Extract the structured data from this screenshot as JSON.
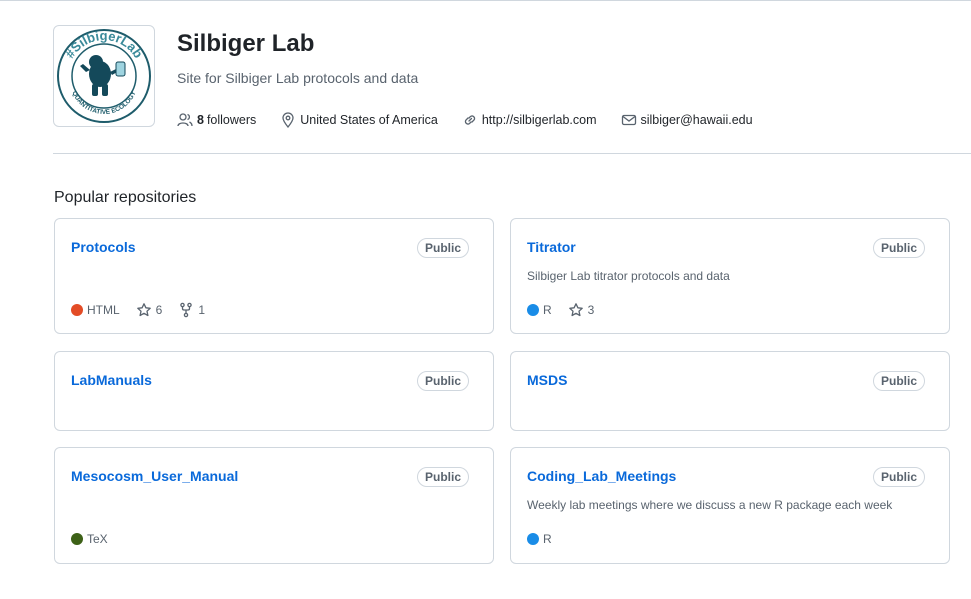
{
  "org": {
    "name": "Silbiger Lab",
    "description": "Site for Silbiger Lab protocols and data",
    "logo_text_top": "#SilbigerLab",
    "logo_text_bottom": "QUANTITATIVE ECOLOGY",
    "followers_count": "8",
    "followers_label": "followers",
    "location": "United States of America",
    "website": "http://silbigerlab.com",
    "email": "silbiger@hawaii.edu"
  },
  "section_title": "Popular repositories",
  "colors": {
    "link": "#0969da",
    "html": "#e34c26",
    "r": "#198ce7",
    "tex": "#3d6117"
  },
  "repos": [
    {
      "name": "Protocols",
      "visibility": "Public",
      "description": "",
      "language": "HTML",
      "stars": "6",
      "forks": "1"
    },
    {
      "name": "Titrator",
      "visibility": "Public",
      "description": "Silbiger Lab titrator protocols and data",
      "language": "R",
      "stars": "3"
    },
    {
      "name": "LabManuals",
      "visibility": "Public",
      "description": ""
    },
    {
      "name": "MSDS",
      "visibility": "Public",
      "description": ""
    },
    {
      "name": "Mesocosm_User_Manual",
      "visibility": "Public",
      "description": "",
      "language": "TeX"
    },
    {
      "name": "Coding_Lab_Meetings",
      "visibility": "Public",
      "description": "Weekly lab meetings where we discuss a new R package each week",
      "language": "R"
    }
  ]
}
